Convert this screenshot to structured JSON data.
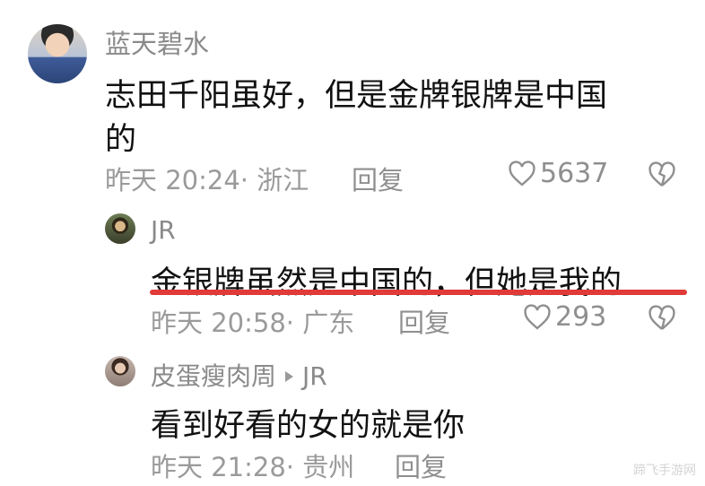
{
  "comments": [
    {
      "username": "蓝天碧水",
      "text_line1": "志田千阳虽好，但是金牌银牌是中国",
      "text_line2": "的",
      "meta": "昨天 20:24· 浙江",
      "reply_label": "回复",
      "like_count": "5637"
    },
    {
      "username": "JR",
      "text": "金银牌虽然是中国的，但她是我的",
      "meta": "昨天 20:58· 广东",
      "reply_label": "回复",
      "like_count": "293",
      "highlight_color": "#e03a3a"
    },
    {
      "username": "皮蛋瘦肉周",
      "reply_to": "JR",
      "text": "看到好看的女的就是你",
      "meta": "昨天 21:28· 贵州",
      "reply_label": "回复"
    }
  ],
  "watermark": "蹄飞手游网"
}
